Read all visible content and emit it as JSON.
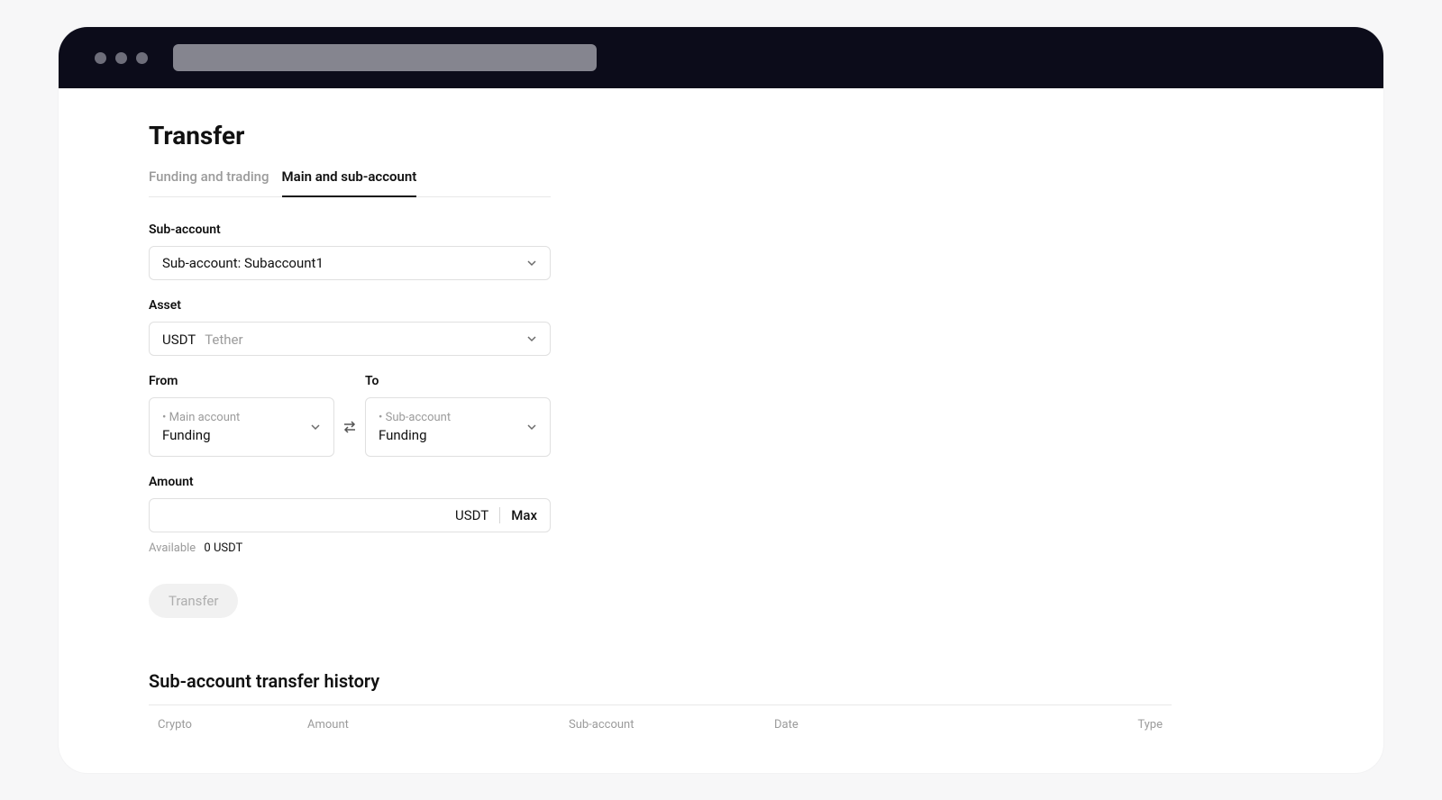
{
  "page": {
    "title": "Transfer"
  },
  "tabs": {
    "funding_trading": "Funding and trading",
    "main_sub": "Main and sub-account"
  },
  "fields": {
    "subaccount": {
      "label": "Sub-account",
      "value": "Sub-account: Subaccount1"
    },
    "asset": {
      "label": "Asset",
      "symbol": "USDT",
      "name": "Tether"
    },
    "from": {
      "label": "From",
      "account_label": "Main account",
      "account_value": "Funding"
    },
    "to": {
      "label": "To",
      "account_label": "Sub-account",
      "account_value": "Funding"
    },
    "amount": {
      "label": "Amount",
      "currency": "USDT",
      "max_label": "Max",
      "available_label": "Available",
      "available_value": "0 USDT"
    }
  },
  "buttons": {
    "transfer": "Transfer"
  },
  "history": {
    "title": "Sub-account transfer history",
    "columns": {
      "crypto": "Crypto",
      "amount": "Amount",
      "subaccount": "Sub-account",
      "date": "Date",
      "type": "Type"
    }
  }
}
